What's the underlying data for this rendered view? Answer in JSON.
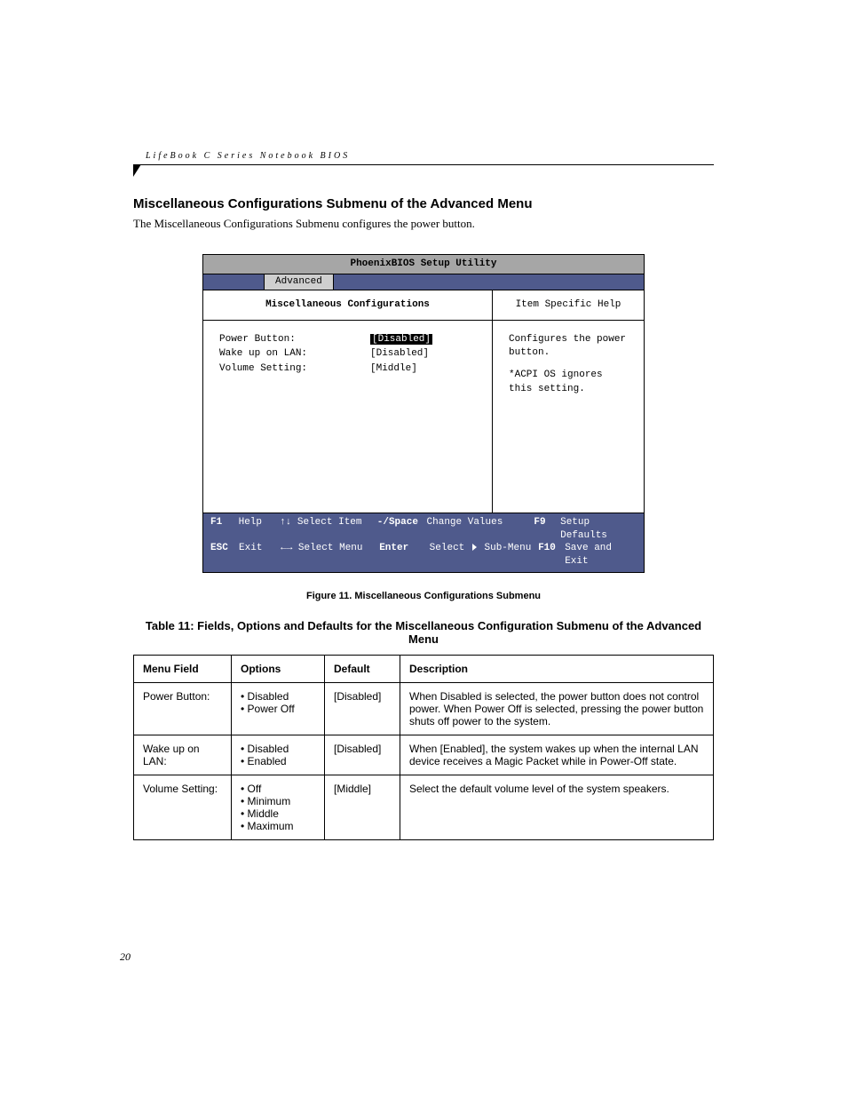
{
  "running_head": "LifeBook C Series Notebook BIOS",
  "section_title": "Miscellaneous Configurations Submenu of the Advanced Menu",
  "intro": "The Miscellaneous Configurations Submenu configures the power button.",
  "bios": {
    "title": "PhoenixBIOS Setup Utility",
    "active_tab": "Advanced",
    "submenu_title": "Miscellaneous Configurations",
    "help_title": "Item Specific Help",
    "rows": [
      {
        "label": "Power Button:",
        "value": "[Disabled]",
        "active": true
      },
      {
        "label": "Wake up on LAN:",
        "value": "[Disabled]",
        "active": false
      },
      {
        "label": "Volume Setting:",
        "value": "[Middle]",
        "active": false
      }
    ],
    "help_text_1": "Configures the power button.",
    "help_text_2": "*ACPI OS ignores this setting.",
    "footer": {
      "r1c1": "F1",
      "r1c2": "Help",
      "r1c3": "↑↓ Select Item",
      "r1c4": "-/Space",
      "r1c5": "Change Values",
      "r1c6": "F9",
      "r1c7": "Setup Defaults",
      "r2c1": "ESC",
      "r2c2": "Exit",
      "r2c3": "←→ Select Menu",
      "r2c4": "Enter",
      "r2c5_a": "Select",
      "r2c5_b": "Sub-Menu",
      "r2c6": "F10",
      "r2c7": "Save and Exit"
    }
  },
  "figure_caption": "Figure 11.  Miscellaneous Configurations Submenu",
  "table_title": "Table 11: Fields, Options and Defaults for the Miscellaneous Configuration Submenu of the Advanced Menu",
  "table": {
    "headers": {
      "field": "Menu Field",
      "options": "Options",
      "default": "Default",
      "desc": "Description"
    },
    "rows": [
      {
        "field": "Power Button:",
        "options": [
          "Disabled",
          "Power Off"
        ],
        "default": "[Disabled]",
        "desc": "When Disabled is selected, the power button does not control power. When Power Off is selected, pressing the power button shuts off power to the system."
      },
      {
        "field": "Wake up on LAN:",
        "options": [
          "Disabled",
          "Enabled"
        ],
        "default": "[Disabled]",
        "desc": "When [Enabled], the system wakes up when the internal LAN device receives a Magic Packet while in Power-Off state."
      },
      {
        "field": "Volume Setting:",
        "options": [
          "Off",
          "Minimum",
          "Middle",
          "Maximum"
        ],
        "default": "[Middle]",
        "desc": "Select the default volume level of the system speakers."
      }
    ]
  },
  "page_number": "20"
}
